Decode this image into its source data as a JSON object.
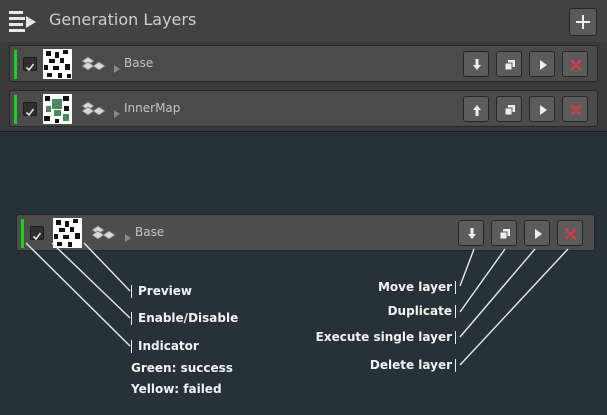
{
  "panel": {
    "title": "Generation Layers",
    "layers": [
      {
        "name": "Base",
        "enabled": true,
        "status": "success",
        "move_direction": "down"
      },
      {
        "name": "InnerMap",
        "enabled": true,
        "status": "success",
        "move_direction": "up"
      }
    ]
  },
  "legend": {
    "row": {
      "name": "Base",
      "enabled": true,
      "status": "success"
    },
    "labels": {
      "preview": "Preview",
      "enable": "Enable/Disable",
      "indicator": "Indicator",
      "green": "Green: success",
      "yellow": "Yellow: failed",
      "move": "Move layer",
      "duplicate": "Duplicate",
      "execute": "Execute single layer",
      "delete": "Delete layer"
    }
  },
  "colors": {
    "background": "#263238",
    "indicator_success": "#19d219",
    "delete_icon": "#e23a3a"
  }
}
